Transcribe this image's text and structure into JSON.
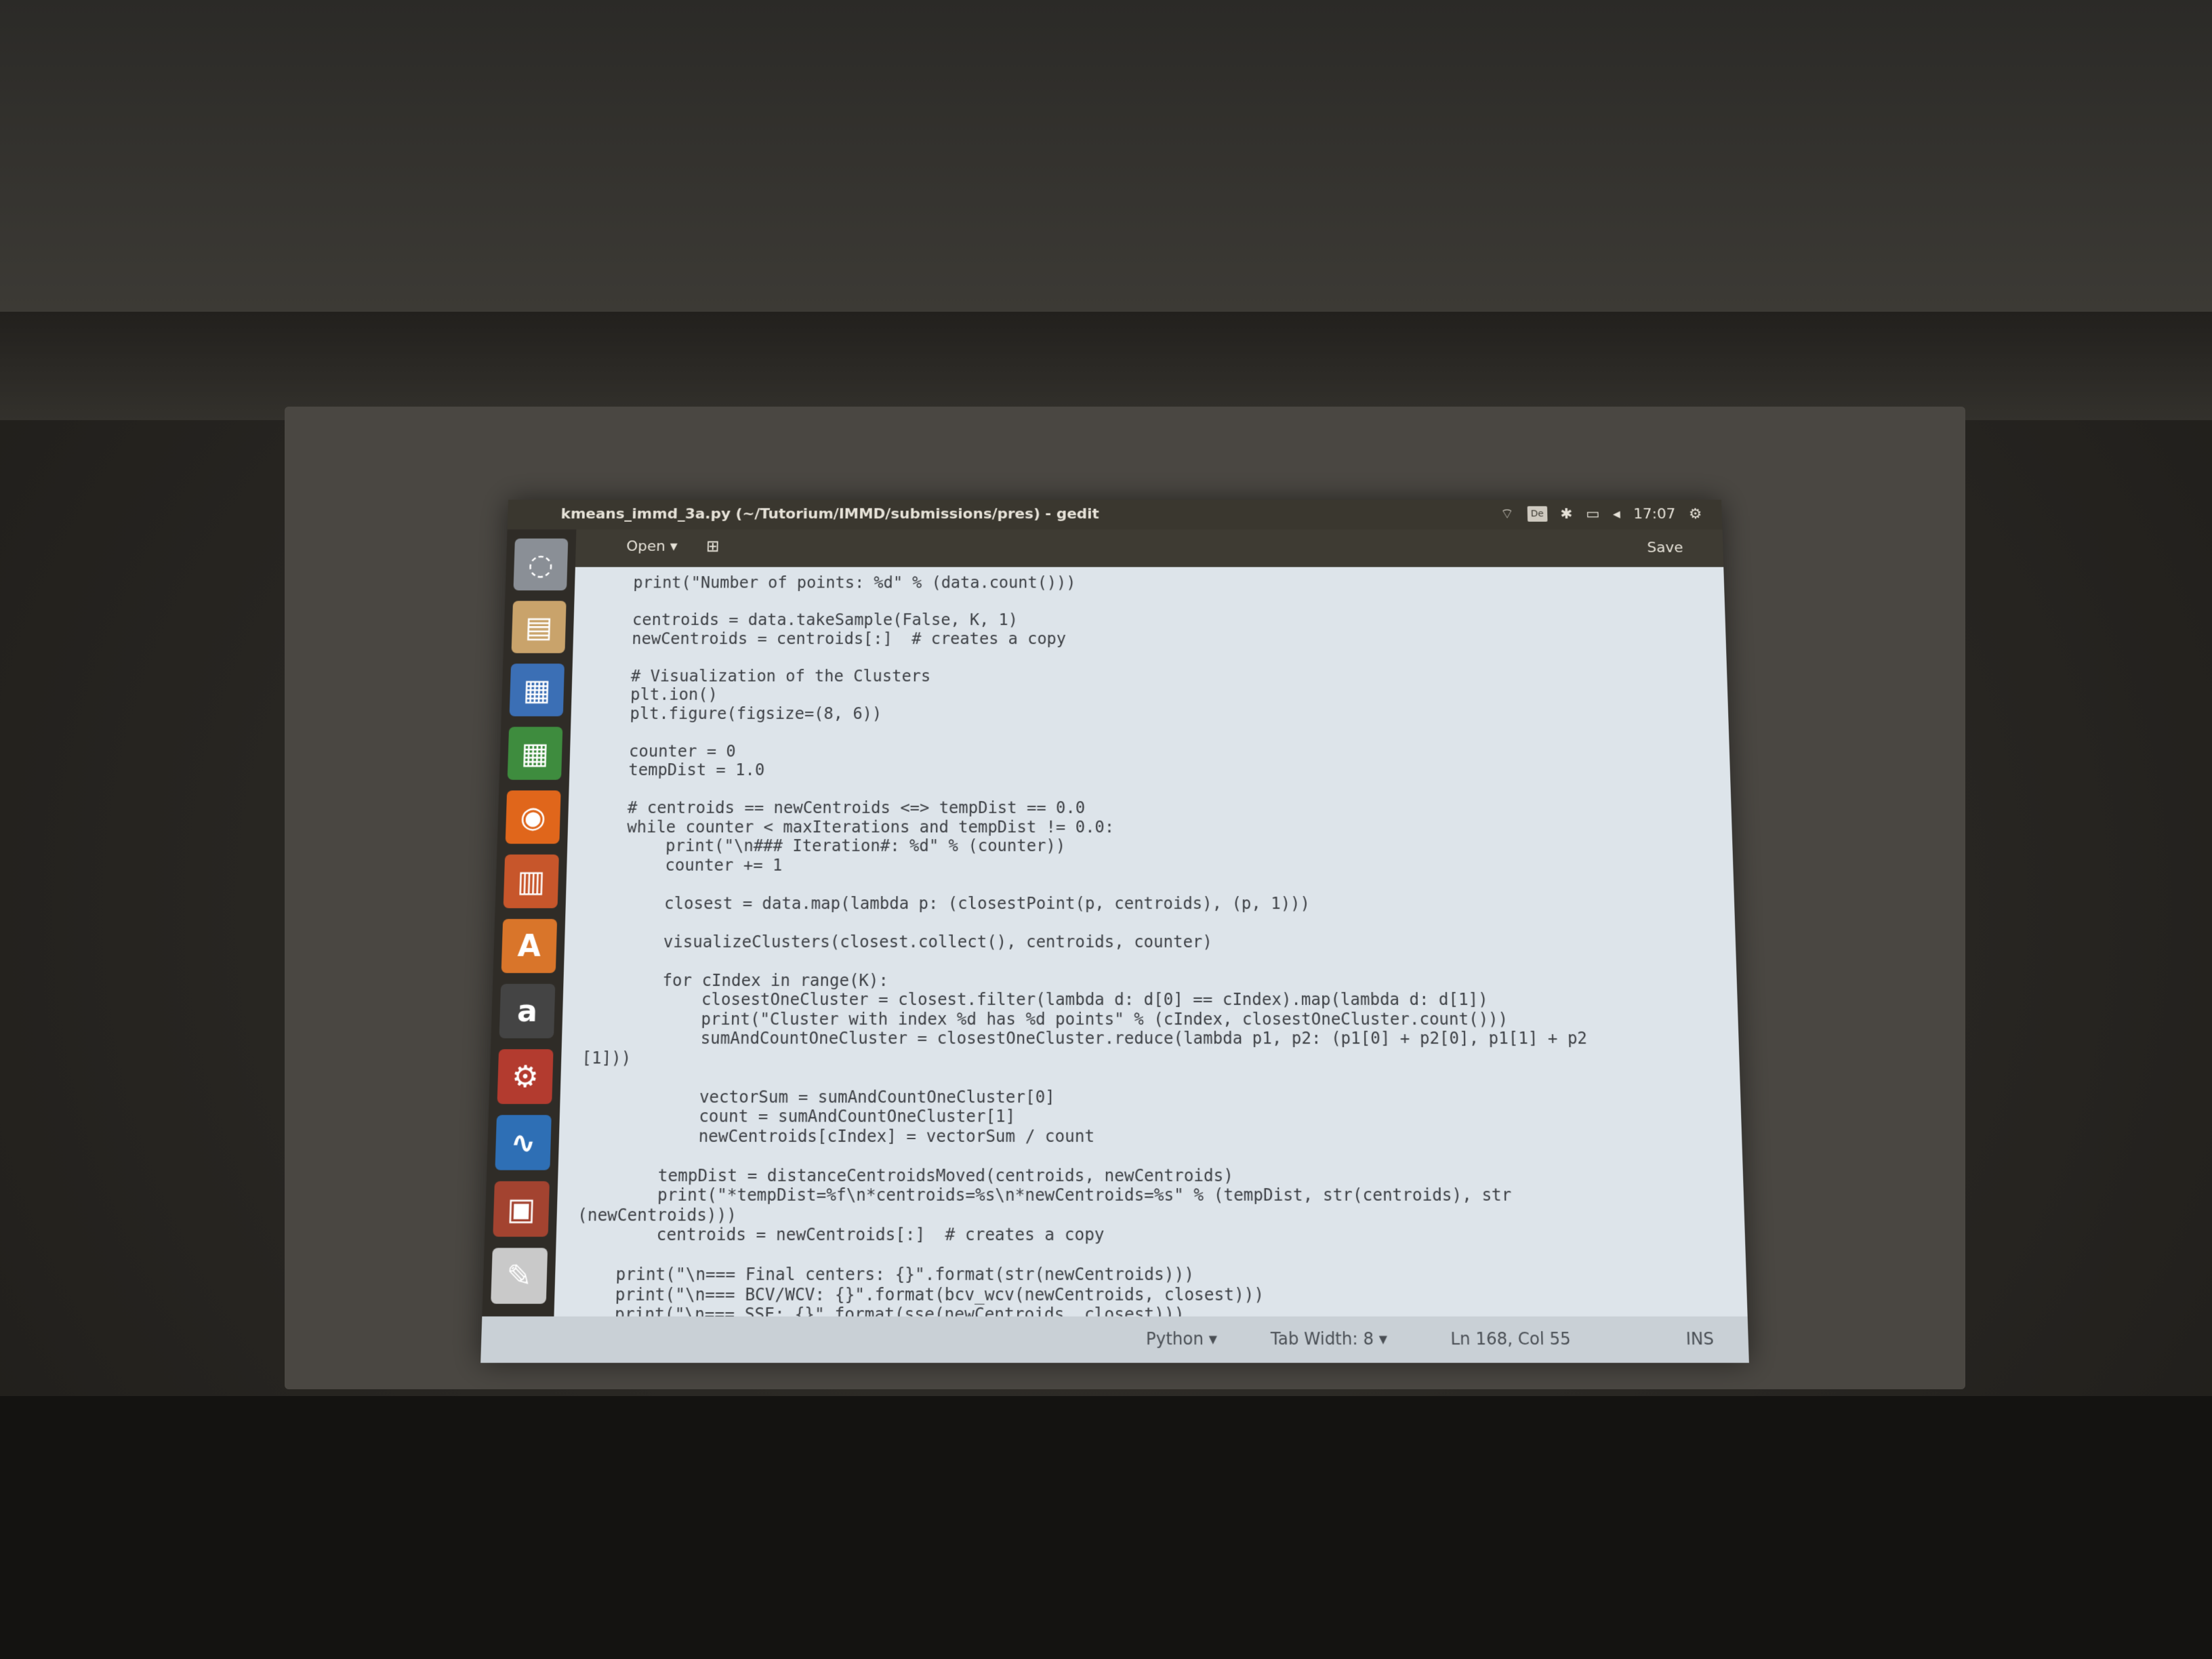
{
  "window": {
    "title": "kmeans_immd_3a.py (~/Tutorium/IMMD/submissions/pres) - gedit",
    "clock": "17:07",
    "keyboard_layout": "De"
  },
  "toolbar": {
    "open_label": "Open ▾",
    "save_label": "Save"
  },
  "launcher": {
    "items": [
      {
        "icon": "ubuntu-dash-icon",
        "glyph": "◌",
        "color": "#8a8f96"
      },
      {
        "icon": "files-icon",
        "glyph": "▤",
        "color": "#c9a36b"
      },
      {
        "icon": "writer-icon",
        "glyph": "▦",
        "color": "#3b6fb5"
      },
      {
        "icon": "calc-icon",
        "glyph": "▦",
        "color": "#3e8c3e"
      },
      {
        "icon": "firefox-icon",
        "glyph": "◉",
        "color": "#e0661b"
      },
      {
        "icon": "impress-icon",
        "glyph": "▥",
        "color": "#c7562b"
      },
      {
        "icon": "software-center-icon",
        "glyph": "A",
        "color": "#d9752a"
      },
      {
        "icon": "amazon-icon",
        "glyph": "a",
        "color": "#444444"
      },
      {
        "icon": "settings-icon",
        "glyph": "⚙",
        "color": "#b33b2f"
      },
      {
        "icon": "system-monitor-icon",
        "glyph": "∿",
        "color": "#2e6fb5"
      },
      {
        "icon": "image-viewer-icon",
        "glyph": "▣",
        "color": "#a34330"
      },
      {
        "icon": "text-editor-icon",
        "glyph": "✎",
        "color": "#c9c9c9"
      }
    ]
  },
  "editor": {
    "code_lines": [
      "    print(\"Number of points: %d\" % (data.count()))",
      "",
      "    centroids = data.takeSample(False, K, 1)",
      "    newCentroids = centroids[:]  # creates a copy",
      "",
      "    # Visualization of the Clusters",
      "    plt.ion()",
      "    plt.figure(figsize=(8, 6))",
      "",
      "    counter = 0",
      "    tempDist = 1.0",
      "",
      "    # centroids == newCentroids <=> tempDist == 0.0",
      "    while counter < maxIterations and tempDist != 0.0:",
      "        print(\"\\n### Iteration#: %d\" % (counter))",
      "        counter += 1",
      "",
      "        closest = data.map(lambda p: (closestPoint(p, centroids), (p, 1)))",
      "",
      "        visualizeClusters(closest.collect(), centroids, counter)",
      "",
      "        for cIndex in range(K):",
      "            closestOneCluster = closest.filter(lambda d: d[0] == cIndex).map(lambda d: d[1])",
      "            print(\"Cluster with index %d has %d points\" % (cIndex, closestOneCluster.count()))",
      "            sumAndCountOneCluster = closestOneCluster.reduce(lambda p1, p2: (p1[0] + p2[0], p1[1] + p2",
      "[1]))",
      "",
      "            vectorSum = sumAndCountOneCluster[0]",
      "            count = sumAndCountOneCluster[1]",
      "            newCentroids[cIndex] = vectorSum / count",
      "",
      "        tempDist = distanceCentroidsMoved(centroids, newCentroids)",
      "        print(\"*tempDist=%f\\n*centroids=%s\\n*newCentroids=%s\" % (tempDist, str(centroids), str",
      "(newCentroids)))",
      "        centroids = newCentroids[:]  # creates a copy",
      "",
      "    print(\"\\n=== Final centers: {}\".format(str(newCentroids)))",
      "    print(\"\\n=== BCV/WCV: {}\".format(bcv_wcv(newCentroids, closest)))",
      "    print(\"\\n=== SSE: {}\".format(sse(newCentroids, closest)))"
    ]
  },
  "statusbar": {
    "language": "Python ▾",
    "tab_width": "Tab Width: 8 ▾",
    "position": "Ln 168, Col 55",
    "mode": "INS"
  }
}
